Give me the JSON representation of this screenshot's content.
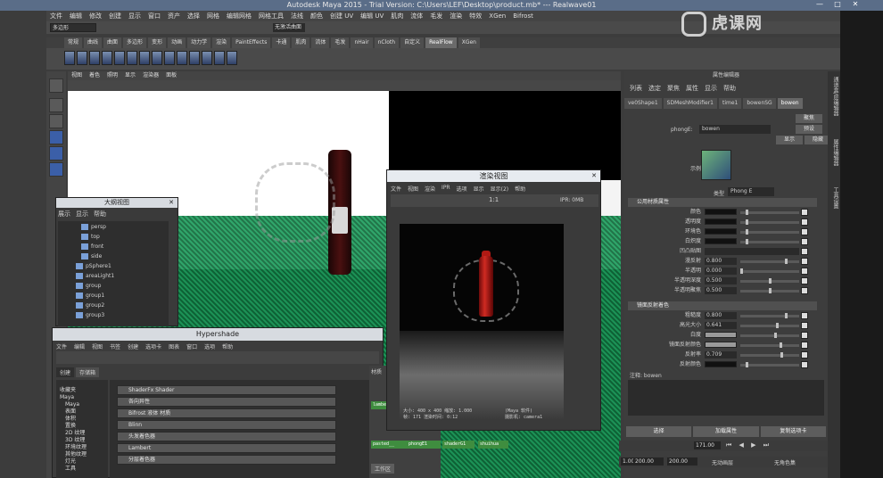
{
  "window": {
    "title": "Autodesk Maya 2015 - Trial Version: C:\\Users\\LEF\\Desktop\\product.mb*  ---  Realwave01",
    "controls": [
      "—",
      "□",
      "✕"
    ]
  },
  "menubar": [
    "文件",
    "编辑",
    "修改",
    "创建",
    "显示",
    "窗口",
    "资产",
    "选择",
    "网格",
    "编辑网格",
    "网格工具",
    "法线",
    "颜色",
    "创建 UV",
    "编辑 UV",
    "肌肉",
    "流体",
    "毛发",
    "渲染",
    "特效",
    "XGen",
    "Bifrost"
  ],
  "status_row": {
    "mode": "多边形",
    "input": "无激活曲面"
  },
  "shelf": {
    "tabs": [
      "常规",
      "曲线",
      "曲面",
      "多边形",
      "变形",
      "动画",
      "动力学",
      "渲染",
      "PaintEffects",
      "卡通",
      "肌肉",
      "流体",
      "毛发",
      "nHair",
      "nCloth",
      "自定义",
      "RealFlow",
      "XGen"
    ],
    "active_tab": "RealFlow"
  },
  "viewport": {
    "menu": [
      "视图",
      "着色",
      "照明",
      "显示",
      "渲染器",
      "面板"
    ]
  },
  "outliner": {
    "title": "大纲视图",
    "menu": [
      "展示",
      "显示",
      "帮助"
    ],
    "items": [
      "persp",
      "top",
      "front",
      "side",
      "pSphere1",
      "areaLight1",
      "group",
      "group1",
      "group2",
      "group3"
    ]
  },
  "hypershade": {
    "title": "Hypershade",
    "menu": [
      "文件",
      "编辑",
      "视图",
      "书签",
      "创建",
      "选项卡",
      "图表",
      "窗口",
      "选项",
      "帮助"
    ],
    "tabs": [
      "创建",
      "存储箱"
    ],
    "active_tab": "创建",
    "tree": [
      "收藏夹",
      "Maya",
      "Maya",
      "表面",
      "体积",
      "置换",
      "2D 纹理",
      "3D 纹理",
      "环境纹理",
      "其他纹理",
      "灯光",
      "工具"
    ],
    "list": [
      "ShaderFx Shader",
      "各向异性",
      "Bifrost 液体 材质",
      "Blinn",
      "头发着色器",
      "Lambert",
      "分层着色器"
    ],
    "right_tab": "材质",
    "work_tab": "工作区",
    "nodes": [
      "lambert1",
      "pasted__",
      "phongE1",
      "shaderG1",
      "shuihua"
    ]
  },
  "renderview": {
    "title": "渲染视图",
    "menu": [
      "文件",
      "视图",
      "渲染",
      "IPR",
      "选项",
      "显示",
      "显示(2)",
      "帮助"
    ],
    "ratio": "1:1",
    "ipr": "IPR: 0MB",
    "info_line1": "大小: 400 x 400  缩放: 1.000",
    "info_line2": "帧: 171    渲染时间: 0:12",
    "info_right1": "(Maya 软件)",
    "info_right2": "摄影机: camera1"
  },
  "attribute_editor": {
    "title": "属性编辑器",
    "menu": [
      "列表",
      "选定",
      "聚焦",
      "属性",
      "显示",
      "帮助"
    ],
    "tabs": [
      "ve0Shape1",
      "SDMeshModifier1",
      "time1",
      "bowenSG",
      "bowen"
    ],
    "active_tab": "bowen",
    "buttons": {
      "focus": "聚焦",
      "preset": "预设",
      "show": "显示",
      "hide": "隐藏"
    },
    "phong_label": "phongE:",
    "phong_value": "bowen",
    "sample_label": "示例",
    "type_label": "类型",
    "type_value": "Phong E",
    "section1": "公用材质属性",
    "rows1": [
      {
        "label": "颜色",
        "kind": "swatch",
        "value": "",
        "knob": 0.1
      },
      {
        "label": "透明度",
        "kind": "swatch",
        "value": "",
        "knob": 0.1
      },
      {
        "label": "环境色",
        "kind": "swatch",
        "value": "",
        "knob": 0.1
      },
      {
        "label": "白炽度",
        "kind": "swatch",
        "value": "",
        "knob": 0.1
      },
      {
        "label": "凹凸贴图",
        "kind": "text",
        "value": "",
        "knob": null
      },
      {
        "label": "漫反射",
        "kind": "val",
        "value": "0.800",
        "knob": 0.8
      },
      {
        "label": "半透明",
        "kind": "val",
        "value": "0.000",
        "knob": 0.0
      },
      {
        "label": "半透明深度",
        "kind": "val",
        "value": "0.500",
        "knob": 0.5
      },
      {
        "label": "半透明聚焦",
        "kind": "val",
        "value": "0.500",
        "knob": 0.5
      }
    ],
    "section2": "镜面反射着色",
    "rows2": [
      {
        "label": "粗糙度",
        "kind": "val",
        "value": "0.800",
        "knob": 0.8
      },
      {
        "label": "高光大小",
        "kind": "val",
        "value": "0.641",
        "knob": 0.64
      },
      {
        "label": "白度",
        "kind": "swatch",
        "value": "",
        "knob": 0.6
      },
      {
        "label": "镜面反射颜色",
        "kind": "swatch",
        "value": "",
        "knob": 0.7
      },
      {
        "label": "反射率",
        "kind": "val",
        "value": "0.709",
        "knob": 0.71
      },
      {
        "label": "反射颜色",
        "kind": "swatch",
        "value": "",
        "knob": 0.1
      }
    ],
    "notes_label": "注释:  bowen",
    "bottom_buttons": [
      "选择",
      "加载属性",
      "复制选项卡"
    ]
  },
  "playback": {
    "frame": "171.00"
  },
  "range": {
    "start": "1.00",
    "end1": "200.00",
    "end2": "200.00",
    "anim_layer": "无动画层",
    "char_set": "无角色集"
  },
  "right_strip": [
    "通道盒/层编辑器",
    "属性编辑器",
    "工具设置"
  ],
  "watermark": "虎课网"
}
